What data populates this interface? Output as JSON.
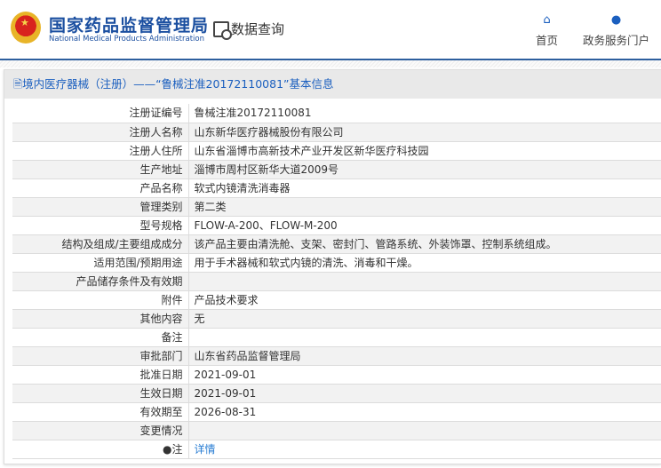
{
  "header": {
    "brand_cn": "国家药品监督管理局",
    "brand_en": "National Medical Products Administration",
    "query": "数据查询",
    "nav": [
      {
        "label": "首页",
        "icon": "home-icon"
      },
      {
        "label": "政务服务门户",
        "icon": "user-icon"
      }
    ]
  },
  "panel": {
    "title": "境内医疗器械（注册）——“鲁械注准20172110081”基本信息"
  },
  "rows": [
    {
      "label": "注册证编号",
      "value": "鲁械注准20172110081"
    },
    {
      "label": "注册人名称",
      "value": "山东新华医疗器械股份有限公司"
    },
    {
      "label": "注册人住所",
      "value": "山东省淄博市高新技术产业开发区新华医疗科技园"
    },
    {
      "label": "生产地址",
      "value": "淄博市周村区新华大道2009号"
    },
    {
      "label": "产品名称",
      "value": "软式内镜清洗消毒器"
    },
    {
      "label": "管理类别",
      "value": "第二类"
    },
    {
      "label": "型号规格",
      "value": "FLOW-A-200、FLOW-M-200"
    },
    {
      "label": "结构及组成/主要组成成分",
      "value": "该产品主要由清洗舱、支架、密封门、管路系统、外装饰罩、控制系统组成。"
    },
    {
      "label": "适用范围/预期用途",
      "value": "用于手术器械和软式内镜的清洗、消毒和干燥。"
    },
    {
      "label": "产品储存条件及有效期",
      "value": ""
    },
    {
      "label": "附件",
      "value": "产品技术要求"
    },
    {
      "label": "其他内容",
      "value": "无"
    },
    {
      "label": "备注",
      "value": ""
    },
    {
      "label": "审批部门",
      "value": "山东省药品监督管理局"
    },
    {
      "label": "批准日期",
      "value": "2021-09-01"
    },
    {
      "label": "生效日期",
      "value": "2021-09-01"
    },
    {
      "label": "有效期至",
      "value": "2026-08-31"
    },
    {
      "label": "变更情况",
      "value": ""
    },
    {
      "label": "注",
      "value": "详情"
    }
  ]
}
